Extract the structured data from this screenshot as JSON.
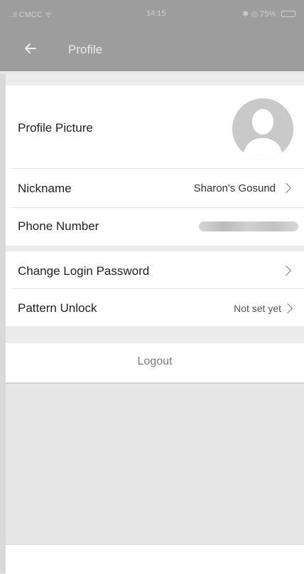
{
  "status_bar": {
    "carrier": "..ıl CMCC ᯤ",
    "time": "14:15",
    "right": "✱ ◎ 75%"
  },
  "app_bar": {
    "title": "Profile"
  },
  "profile": {
    "picture_label": "Profile Picture",
    "nickname_label": "Nickname",
    "nickname_value": "Sharon's Gosund",
    "phone_label": "Phone Number"
  },
  "security": {
    "change_password_label": "Change Login Password",
    "pattern_unlock_label": "Pattern Unlock",
    "pattern_unlock_value": "Not set yet"
  },
  "logout": {
    "label": "Logout"
  },
  "colors": {
    "header": "#9d9d9d",
    "background": "#e6e6e6",
    "card": "#ffffff"
  }
}
